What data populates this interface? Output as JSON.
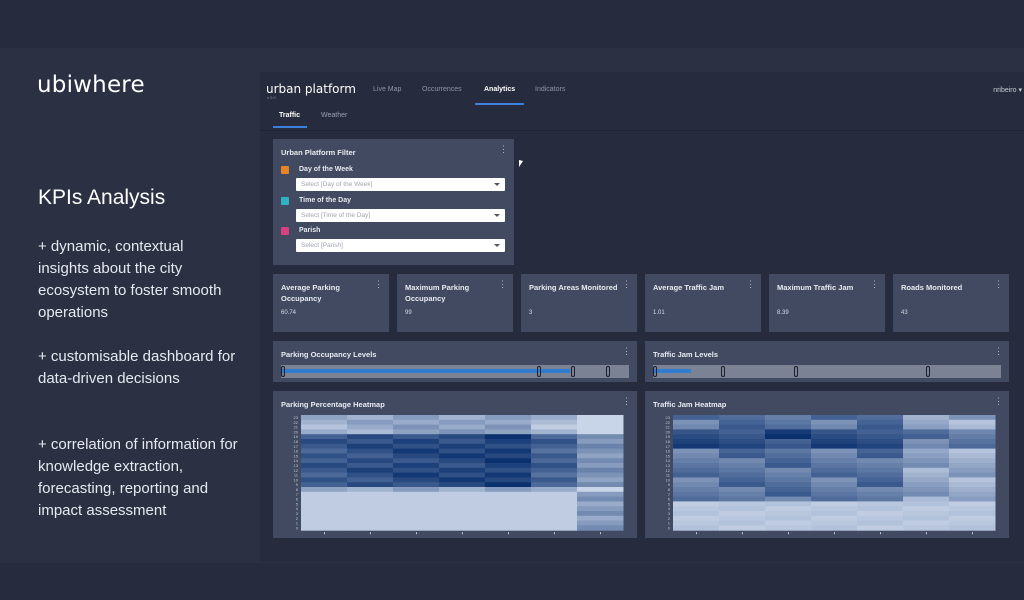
{
  "brand": {
    "logo": "ubiwhere"
  },
  "promo": {
    "title": "KPIs Analysis",
    "points": [
      "+ dynamic, contextual insights about the city ecosystem to foster smooth operations",
      "+ customisable dashboard for data-driven decisions",
      "+ correlation of information for knowledge extraction, forecasting, reporting and impact assessment"
    ]
  },
  "app": {
    "logo": "urban platform",
    "version": "v 0.0",
    "nav": [
      "Live Map",
      "Occurrences",
      "Analytics",
      "Indicators"
    ],
    "active_nav": "Analytics",
    "user": "nribeiro ▾",
    "subtabs": [
      "Traffic",
      "Weather"
    ],
    "active_subtab": "Traffic"
  },
  "filter_panel": {
    "title": "Urban Platform Filter",
    "filters": [
      {
        "label": "Day of the Week",
        "placeholder": "Select [Day of the Week]",
        "icon": "filter-icon",
        "color": "#e8832a"
      },
      {
        "label": "Time of the Day",
        "placeholder": "Select [Time of the Day]",
        "icon": "filter-icon",
        "color": "#2fb3c4"
      },
      {
        "label": "Parish",
        "placeholder": "Select [Parish]",
        "icon": "filter-icon",
        "color": "#d9407f"
      }
    ]
  },
  "kpis": [
    {
      "title": "Average Parking Occupancy",
      "value": "60.74"
    },
    {
      "title": "Maximum Parking Occupancy",
      "value": "99"
    },
    {
      "title": "Parking Areas Monitored",
      "value": "3"
    },
    {
      "title": "Average Traffic Jam",
      "value": "1.01"
    },
    {
      "title": "Maximum Traffic Jam",
      "value": "8.39"
    },
    {
      "title": "Roads Monitored",
      "value": "43"
    }
  ],
  "levels": [
    {
      "title": "Parking Occupancy Levels",
      "fill": 0.83,
      "markers": [
        0.0,
        0.74,
        0.84,
        0.94
      ]
    },
    {
      "title": "Traffic Jam Levels",
      "fill": 0.11,
      "markers": [
        0.0,
        0.2,
        0.41,
        0.79
      ]
    }
  ],
  "heatmaps": [
    {
      "title": "Parking Percentage Heatmap"
    },
    {
      "title": "Traffic Jam Heatmap"
    }
  ],
  "colors": {
    "accent": "#3d7fdc",
    "panel": "#414a60",
    "background": "#262c3d"
  }
}
